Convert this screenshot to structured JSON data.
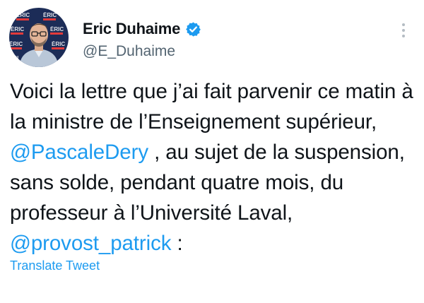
{
  "author": {
    "name": "Eric Duhaime",
    "handle": "@E_Duhaime",
    "verified": true,
    "avatar_icon": "profile-photo",
    "avatar_backdrop_text": "ERIC DUHAIME"
  },
  "tweet": {
    "segments": [
      {
        "text": "Voici la lettre que j’ai fait parvenir ce matin à la ministre de l’Enseignement supérieur, ",
        "type": "text"
      },
      {
        "text": "@PascaleDery",
        "type": "mention"
      },
      {
        "text": " , au sujet de la suspension, sans solde, pendant quatre mois, du professeur à l’Université Laval, ",
        "type": "text"
      },
      {
        "text": "@provost_patrick",
        "type": "mention"
      },
      {
        "text": " :",
        "type": "text"
      }
    ]
  },
  "actions": {
    "translate_label": "Translate Tweet",
    "more_icon": "more-vertical-icon"
  },
  "colors": {
    "accent": "#1d9bf0",
    "text": "#0f1419",
    "muted": "#536471",
    "avatar_bg": "#1c2c57"
  }
}
